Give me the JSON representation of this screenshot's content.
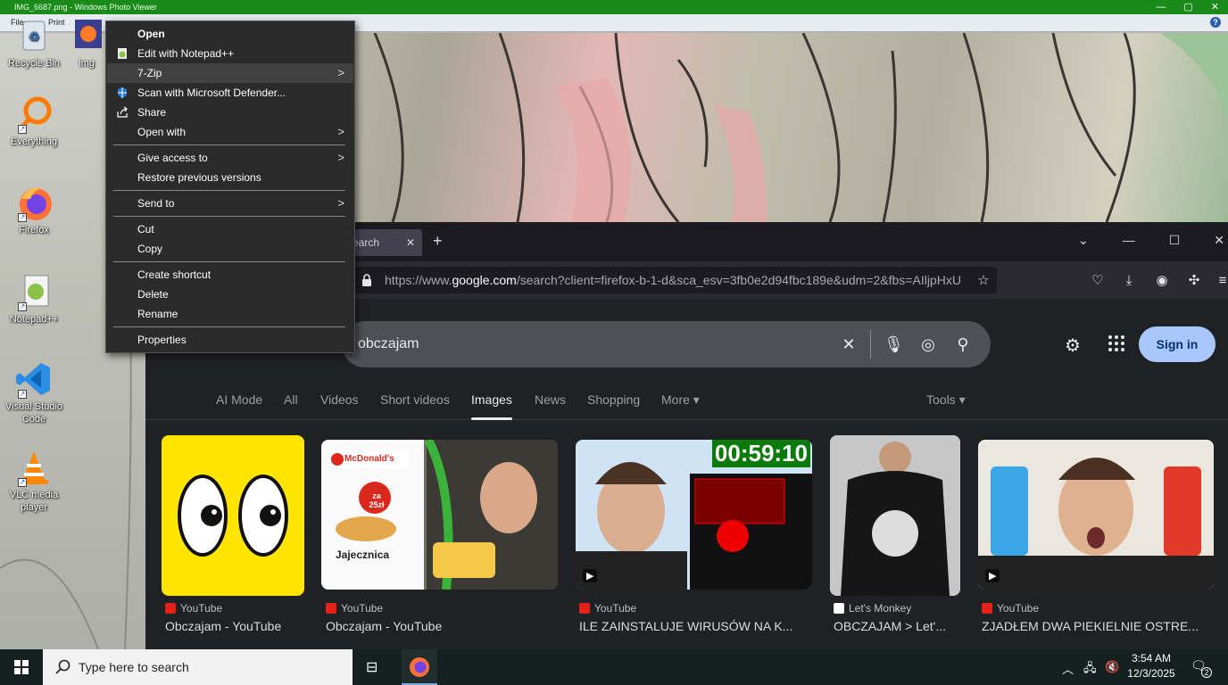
{
  "photo_viewer": {
    "title": "IMG_6687.png - Windows Photo Viewer",
    "menu": [
      "File",
      "Print"
    ]
  },
  "desktop_icons": [
    {
      "label": "Recycle Bin",
      "icon": "recycle-bin-icon"
    },
    {
      "label": "img",
      "icon": "firefox-image-icon"
    },
    {
      "label": "Everything",
      "icon": "everything-search-icon"
    },
    {
      "label": "Firefox",
      "icon": "firefox-icon"
    },
    {
      "label": "Notepad++",
      "icon": "notepad-plus-plus-icon"
    },
    {
      "label": "Visual Studio Code",
      "icon": "vscode-icon"
    },
    {
      "label": "VLC media player",
      "icon": "vlc-icon"
    }
  ],
  "context_menu": {
    "open": "Open",
    "edit_notepad": "Edit with Notepad++",
    "seven_zip": "7-Zip",
    "scan_defender": "Scan with Microsoft Defender...",
    "share": "Share",
    "open_with": "Open with",
    "give_access": "Give access to",
    "restore_versions": "Restore previous versions",
    "send_to": "Send to",
    "cut": "Cut",
    "copy": "Copy",
    "create_shortcut": "Create shortcut",
    "delete": "Delete",
    "rename": "Rename",
    "properties": "Properties",
    "submenu_arrow": ">"
  },
  "firefox": {
    "tab_label": "earch",
    "tab_close": "✕",
    "new_tab": "+",
    "url_prefix": "https://www.",
    "url_domain": "google.com",
    "url_rest": "/search?client=firefox-b-1-d&sca_esv=3fb0e2d94fbc189e&udm=2&fbs=AIljpHxU"
  },
  "google": {
    "query": "obczajam",
    "signin": "Sign in",
    "tabs": [
      "AI Mode",
      "All",
      "Videos",
      "Short videos",
      "Images",
      "News",
      "Shopping",
      "More ▾"
    ],
    "active_tab": "Images",
    "tools": "Tools ▾",
    "results": [
      {
        "source": "YouTube",
        "title": "Obczajam - YouTube"
      },
      {
        "source": "YouTube",
        "title": "Obczajam - YouTube"
      },
      {
        "source": "YouTube",
        "title": "ILE ZAINSTALUJE WIRUSÓW NA K..."
      },
      {
        "source": "Let's Monkey",
        "title": "OBCZAJAM > Let'..."
      },
      {
        "source": "YouTube",
        "title": "ZJADŁEM DWA PIEKIELNIE OSTRE..."
      }
    ],
    "thumb_texts": {
      "mcd_brand": "McDonald's",
      "mcd_price": "za 25zł",
      "mcd_item": "Jajecznica",
      "timer": "00:59:10"
    }
  },
  "taskbar": {
    "search_placeholder": "Type here to search",
    "time": "3:54 AM",
    "date": "12/3/2025",
    "notifications": "2"
  },
  "colors": {
    "photo_titlebar": "#1a8a1a",
    "menu_bg": "#2b2b2b",
    "google_bg": "#202124",
    "signin_bg": "#a8c7fa",
    "taskbar": "#15211f"
  }
}
